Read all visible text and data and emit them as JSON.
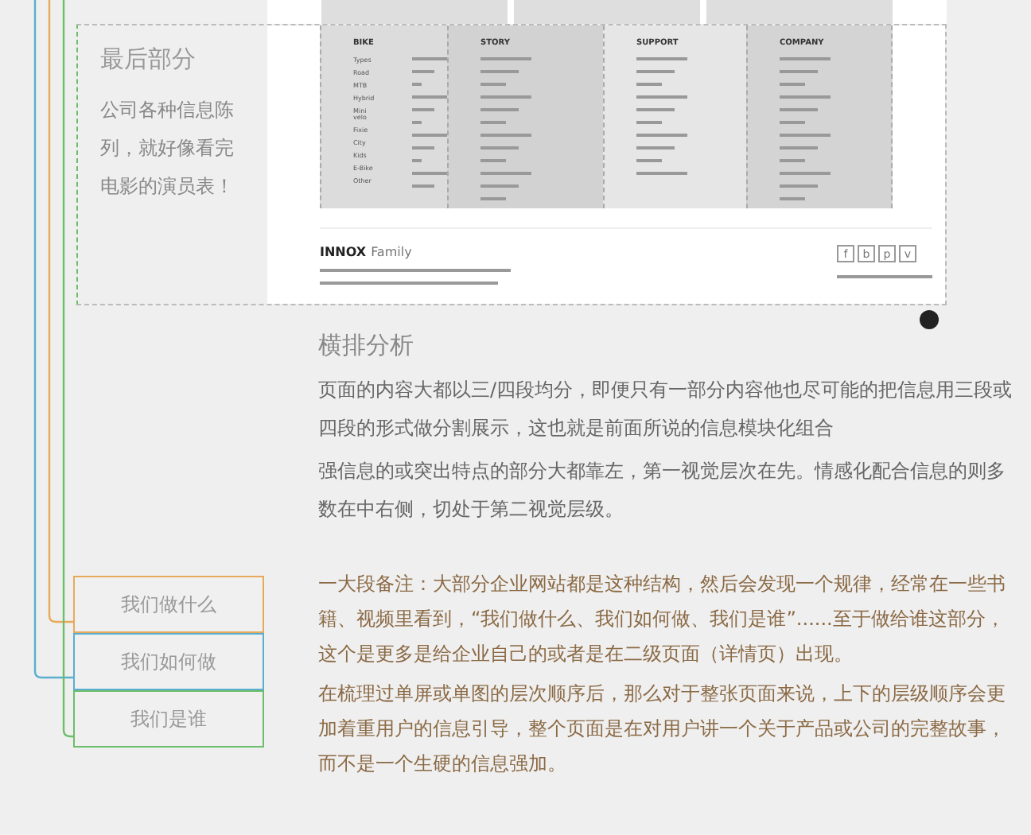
{
  "annotation": {
    "title": "最后部分",
    "text": "公司各种信息陈列，就好像看完电影的演员表！"
  },
  "mockup": {
    "columns": [
      {
        "heading": "BIKE",
        "items": [
          "Types",
          "Road",
          "MTB",
          "Hybrid",
          "Mini velo",
          "Fixie",
          "City",
          "Kids",
          "E-Bike",
          "Other"
        ]
      },
      {
        "heading": "STORY"
      },
      {
        "heading": "SUPPORT"
      },
      {
        "heading": "COMPANY"
      }
    ],
    "footer": {
      "logo_bold": "INNOX",
      "logo_light": "Family",
      "social": [
        "f",
        "b",
        "p",
        "v"
      ]
    }
  },
  "analysis": {
    "heading": "横排分析",
    "paragraphs": [
      "页面的内容大都以三/四段均分，即便只有一部分内容他也尽可能的把信息用三段或四段的形式做分割展示，这也就是前面所说的信息模块化组合",
      "强信息的或突出特点的部分大都靠左，第一视觉层次在先。情感化配合信息的则多数在中右侧，切处于第二视觉层级。"
    ]
  },
  "sections": [
    {
      "label": "我们做什么",
      "color": "#e8a95a"
    },
    {
      "label": "我们如何做",
      "color": "#5aaed0"
    },
    {
      "label": "我们是谁",
      "color": "#6cbf6a"
    }
  ],
  "notes": [
    "一大段备注：大部分企业网站都是这种结构，然后会发现一个规律，经常在一些书籍、视频里看到，“我们做什么、我们如何做、我们是谁”......至于做给谁这部分，这个是更多是给企业自己的或者是在二级页面（详情页）出现。",
    "在梳理过单屏或单图的层次顺序后，那么对于整张页面来说，上下的层级顺序会更加着重用户的信息引导，整个页面是在对用户讲一个关于产品或公司的完整故事，而不是一个生硬的信息强加。"
  ]
}
